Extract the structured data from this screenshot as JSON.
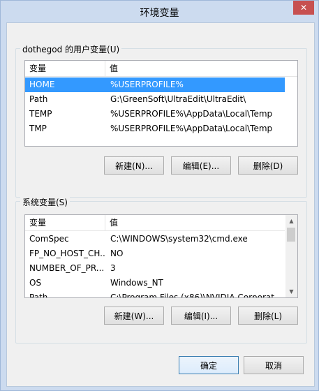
{
  "window": {
    "title": "环境变量",
    "close_glyph": "✕"
  },
  "user_vars": {
    "group_label": "dothegod 的用户变量(U)",
    "header": {
      "var": "变量",
      "val": "值"
    },
    "rows": [
      {
        "var": "HOME",
        "val": "%USERPROFILE%",
        "selected": true
      },
      {
        "var": "Path",
        "val": "G:\\GreenSoft\\UltraEdit\\UltraEdit\\"
      },
      {
        "var": "TEMP",
        "val": "%USERPROFILE%\\AppData\\Local\\Temp"
      },
      {
        "var": "TMP",
        "val": "%USERPROFILE%\\AppData\\Local\\Temp"
      }
    ],
    "buttons": {
      "new": "新建(N)...",
      "edit": "编辑(E)...",
      "delete": "删除(D)"
    }
  },
  "system_vars": {
    "group_label": "系统变量(S)",
    "header": {
      "var": "变量",
      "val": "值"
    },
    "rows": [
      {
        "var": "ComSpec",
        "val": "C:\\WINDOWS\\system32\\cmd.exe"
      },
      {
        "var": "FP_NO_HOST_CH...",
        "val": "NO"
      },
      {
        "var": "NUMBER_OF_PR...",
        "val": "3"
      },
      {
        "var": "OS",
        "val": "Windows_NT"
      },
      {
        "var": "Path",
        "val": "C:\\Program Files (x86)\\NVIDIA Corporat..."
      }
    ],
    "buttons": {
      "new": "新建(W)...",
      "edit": "编辑(I)...",
      "delete": "删除(L)"
    }
  },
  "footer": {
    "ok": "确定",
    "cancel": "取消"
  },
  "colors": {
    "selection": "#3399ff",
    "frame": "#ccdbef"
  }
}
